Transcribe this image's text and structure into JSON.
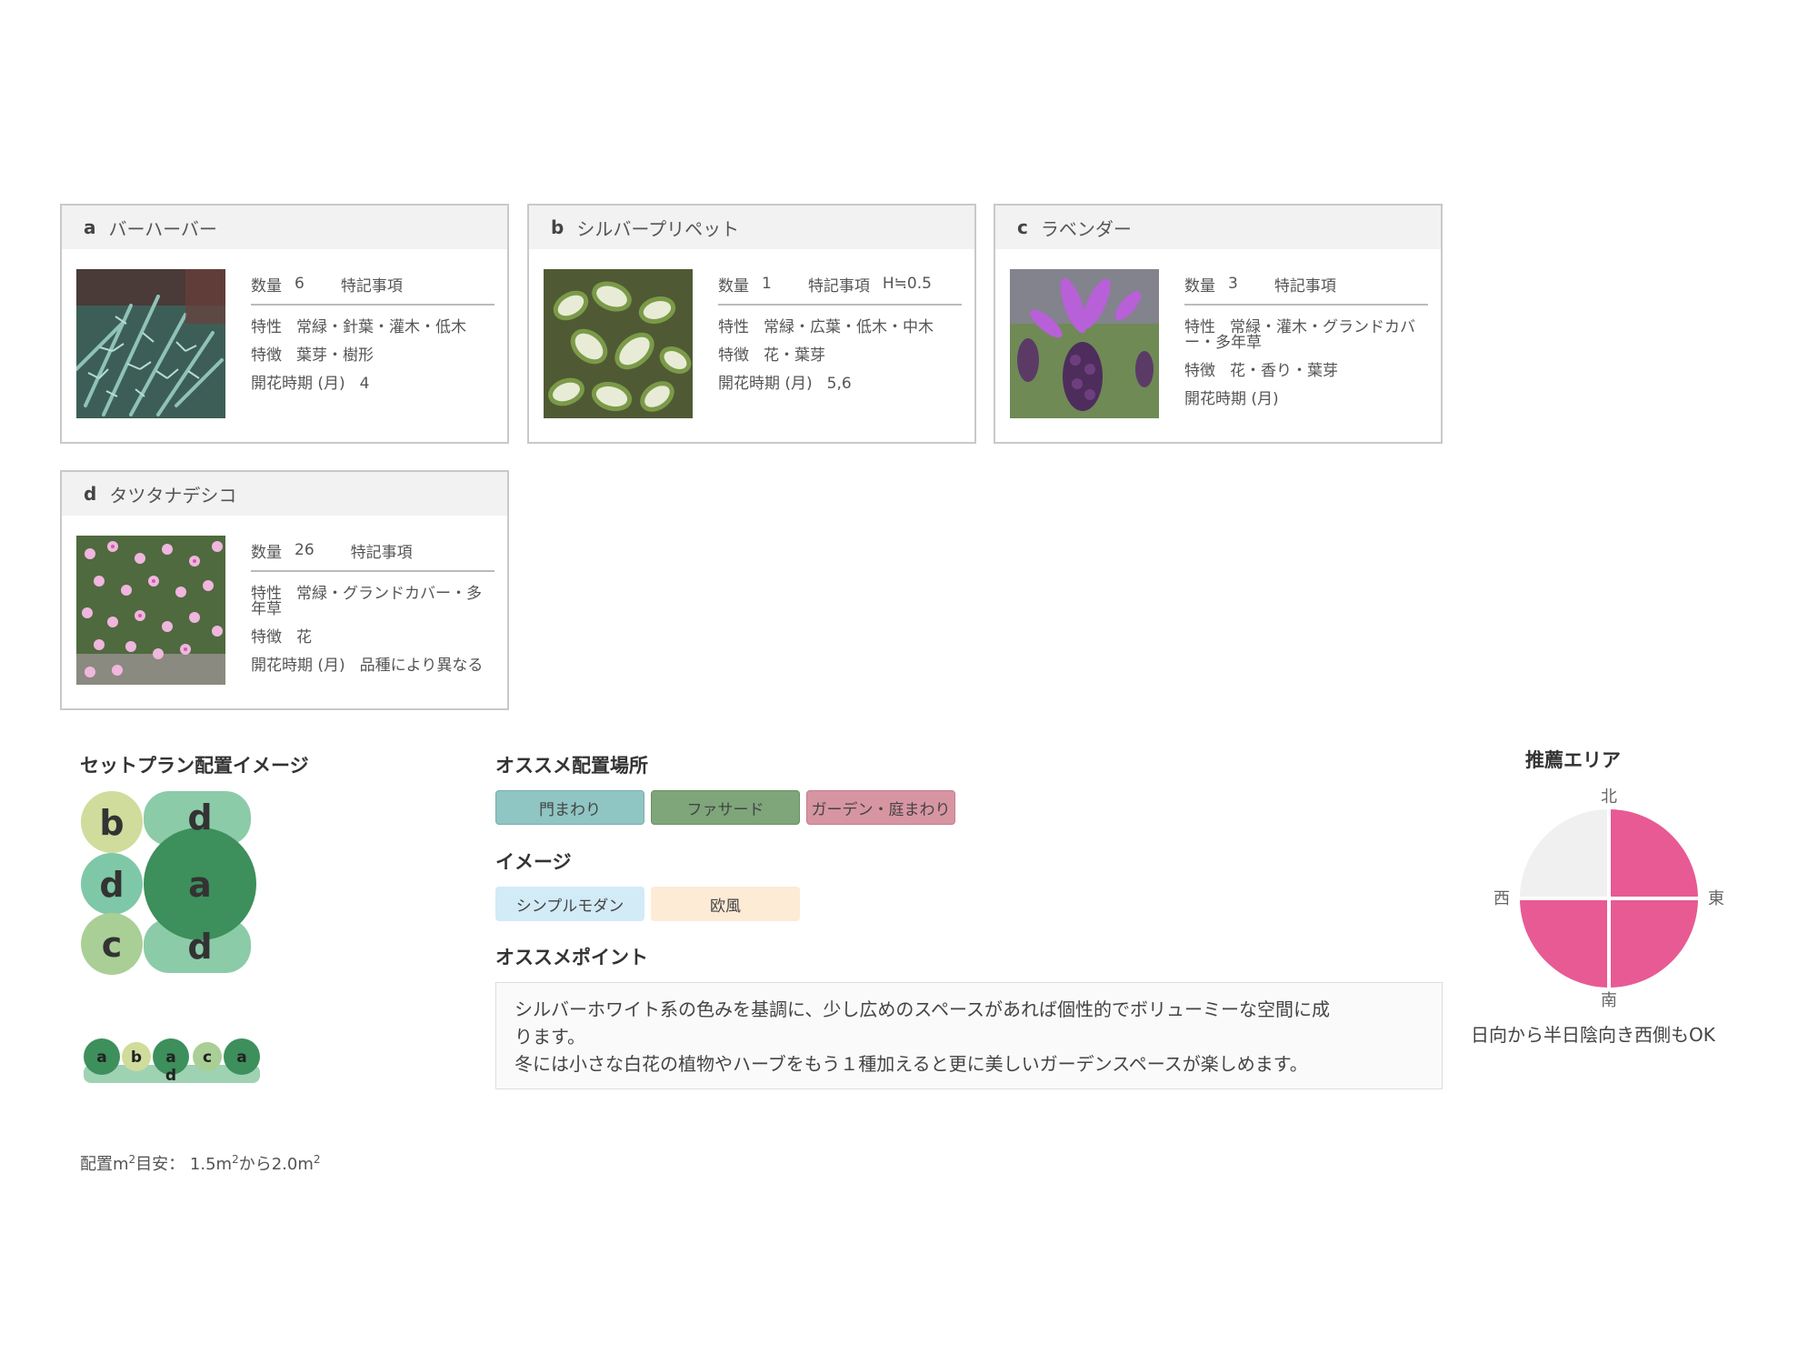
{
  "plants": [
    {
      "letter": "a",
      "name": "バーハーバー",
      "qty_label": "数量",
      "qty": "6",
      "note_label": "特記事項",
      "note": "",
      "trait_label": "特性",
      "trait": "常緑・針葉・灌木・低木",
      "feature_label": "特徴",
      "feature": "葉芽・樹形",
      "bloom_label": "開花時期 (月)",
      "bloom": "4"
    },
    {
      "letter": "b",
      "name": "シルバープリペット",
      "qty_label": "数量",
      "qty": "1",
      "note_label": "特記事項",
      "note": "H≒0.5",
      "trait_label": "特性",
      "trait": "常緑・広葉・低木・中木",
      "feature_label": "特徴",
      "feature": "花・葉芽",
      "bloom_label": "開花時期 (月)",
      "bloom": "5,6"
    },
    {
      "letter": "c",
      "name": "ラベンダー",
      "qty_label": "数量",
      "qty": "3",
      "note_label": "特記事項",
      "note": "",
      "trait_label": "特性",
      "trait": "常緑・灌木・グランドカバー・多年草",
      "feature_label": "特徴",
      "feature": "花・香り・葉芽",
      "bloom_label": "開花時期 (月)",
      "bloom": ""
    },
    {
      "letter": "d",
      "name": "タツタナデシコ",
      "qty_label": "数量",
      "qty": "26",
      "note_label": "特記事項",
      "note": "",
      "trait_label": "特性",
      "trait": "常緑・グランドカバー・多年草",
      "feature_label": "特徴",
      "feature": "花",
      "bloom_label": "開花時期 (月)",
      "bloom": "品種により異なる"
    }
  ],
  "layout_section": {
    "title": "セットプラン配置イメージ",
    "size_label": "配置m",
    "size_mid": "目安： 1.5m",
    "size_to": "から2.0m",
    "sup": "2"
  },
  "plan_letters": {
    "b": "b",
    "d": "d",
    "a": "a",
    "c": "c"
  },
  "row_letters": [
    "a",
    "b",
    "a",
    "c",
    "a",
    "d"
  ],
  "placement": {
    "title": "オススメ配置場所",
    "tags": [
      "門まわり",
      "ファサード",
      "ガーデン・庭まわり"
    ],
    "colors": [
      "#8fc5c3",
      "#7ea67a",
      "#d795a2"
    ]
  },
  "image_section": {
    "title": "イメージ",
    "tags": [
      "シンプルモダン",
      "欧風"
    ],
    "colors": [
      "#d2ebf7",
      "#fdebd6"
    ]
  },
  "point": {
    "title": "オススメポイント",
    "line1": "シルバーホワイト系の色みを基調に、少し広めのスペースがあれば個性的でボリューミーな空間に成",
    "line2": "ります。",
    "line3": "冬には小さな白花の植物やハーブをもう１種加えると更に美しいガーデンスペースが楽しめます。"
  },
  "area": {
    "title": "推薦エリア",
    "north": "北",
    "south": "南",
    "east": "東",
    "west": "西",
    "note": "日向から半日陰向き西側もOK",
    "active_color": "#e85a93",
    "inactive_color": "#f0f0f0"
  }
}
